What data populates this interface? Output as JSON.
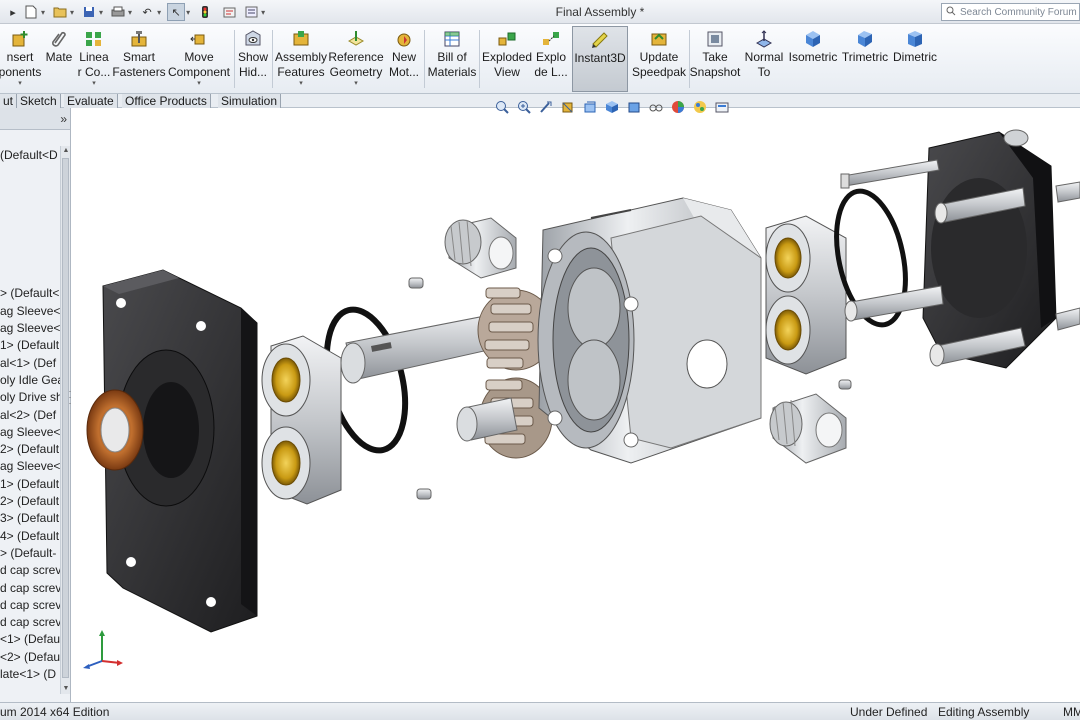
{
  "window": {
    "title": "Final Assembly *",
    "search_placeholder": "Search Community Forum"
  },
  "command_manager": {
    "tools": [
      {
        "id": "insert-components",
        "label": "nsert\nponents",
        "icon": "insert-components-icon"
      },
      {
        "id": "mate",
        "label": "Mate",
        "icon": "paperclip-icon"
      },
      {
        "id": "linear-component-pattern",
        "label": "Linea\nr Co...",
        "icon": "linear-pattern-icon"
      },
      {
        "id": "smart-fasteners",
        "label": "Smart\nFasteners",
        "icon": "smart-fasteners-icon"
      },
      {
        "id": "move-component",
        "label": "Move\nComponent",
        "icon": "move-component-icon"
      },
      {
        "id": "show-hidden",
        "label": "Show\nHid...",
        "icon": "show-hidden-icon"
      },
      {
        "id": "assembly-features",
        "label": "Assembly\nFeatures",
        "icon": "assembly-features-icon"
      },
      {
        "id": "reference-geometry",
        "label": "Reference\nGeometry",
        "icon": "reference-geometry-icon"
      },
      {
        "id": "new-motion-study",
        "label": "New\nMot...",
        "icon": "motion-study-icon"
      },
      {
        "id": "bill-of-materials",
        "label": "Bill of\nMaterials",
        "icon": "bom-icon"
      },
      {
        "id": "exploded-view",
        "label": "Exploded\nView",
        "icon": "exploded-view-icon"
      },
      {
        "id": "explode-line-sketch",
        "label": "Explo\nde L...",
        "icon": "explode-line-icon"
      },
      {
        "id": "instant3d",
        "label": "Instant3D",
        "icon": "instant3d-icon"
      },
      {
        "id": "update-speedpak",
        "label": "Update\nSpeedpak",
        "icon": "speedpak-icon"
      },
      {
        "id": "take-snapshot",
        "label": "Take\nSnapshot",
        "icon": "snapshot-icon"
      },
      {
        "id": "normal-to",
        "label": "Normal\nTo",
        "icon": "normal-to-icon"
      },
      {
        "id": "isometric",
        "label": "Isometric",
        "icon": "isometric-cube-icon"
      },
      {
        "id": "trimetric",
        "label": "Trimetric",
        "icon": "trimetric-cube-icon"
      },
      {
        "id": "dimetric",
        "label": "Dimetric",
        "icon": "dimetric-cube-icon"
      }
    ],
    "active_tool": "instant3d"
  },
  "tabs": [
    "ut",
    "Sketch",
    "Evaluate",
    "Office Products",
    "Simulation"
  ],
  "feature_tree": {
    "expand_glyph": "»",
    "items": [
      "(Default<D",
      "",
      "",
      "",
      "",
      "",
      "",
      "",
      "> (Default<",
      "ag Sleeve<",
      "ag Sleeve<",
      "1> (Default",
      "al<1> (Def",
      "oly Idle Gea",
      "oly Drive sh",
      "al<2> (Def",
      "ag Sleeve<",
      "2> (Default",
      "ag Sleeve<",
      "1> (Default",
      "2> (Default",
      "3> (Default",
      "4> (Default",
      "> (Default-",
      "d cap screv",
      "d cap screv",
      "d cap screv",
      "d cap screv",
      "<1> (Defaul",
      "<2> (Defaul",
      "late<1> (D"
    ]
  },
  "status_bar": {
    "edition": "um 2014 x64 Edition",
    "definition_state": "Under Defined",
    "mode": "Editing Assembly",
    "units": "MM"
  },
  "colors": {
    "accent": "#4a90d9",
    "active_tool_bg": "#c4cad1",
    "housing": "#b9bcc0",
    "cover_plate": "#2b2b2d",
    "bushing": "#d4a017",
    "copper_seal": "#b5642a"
  }
}
